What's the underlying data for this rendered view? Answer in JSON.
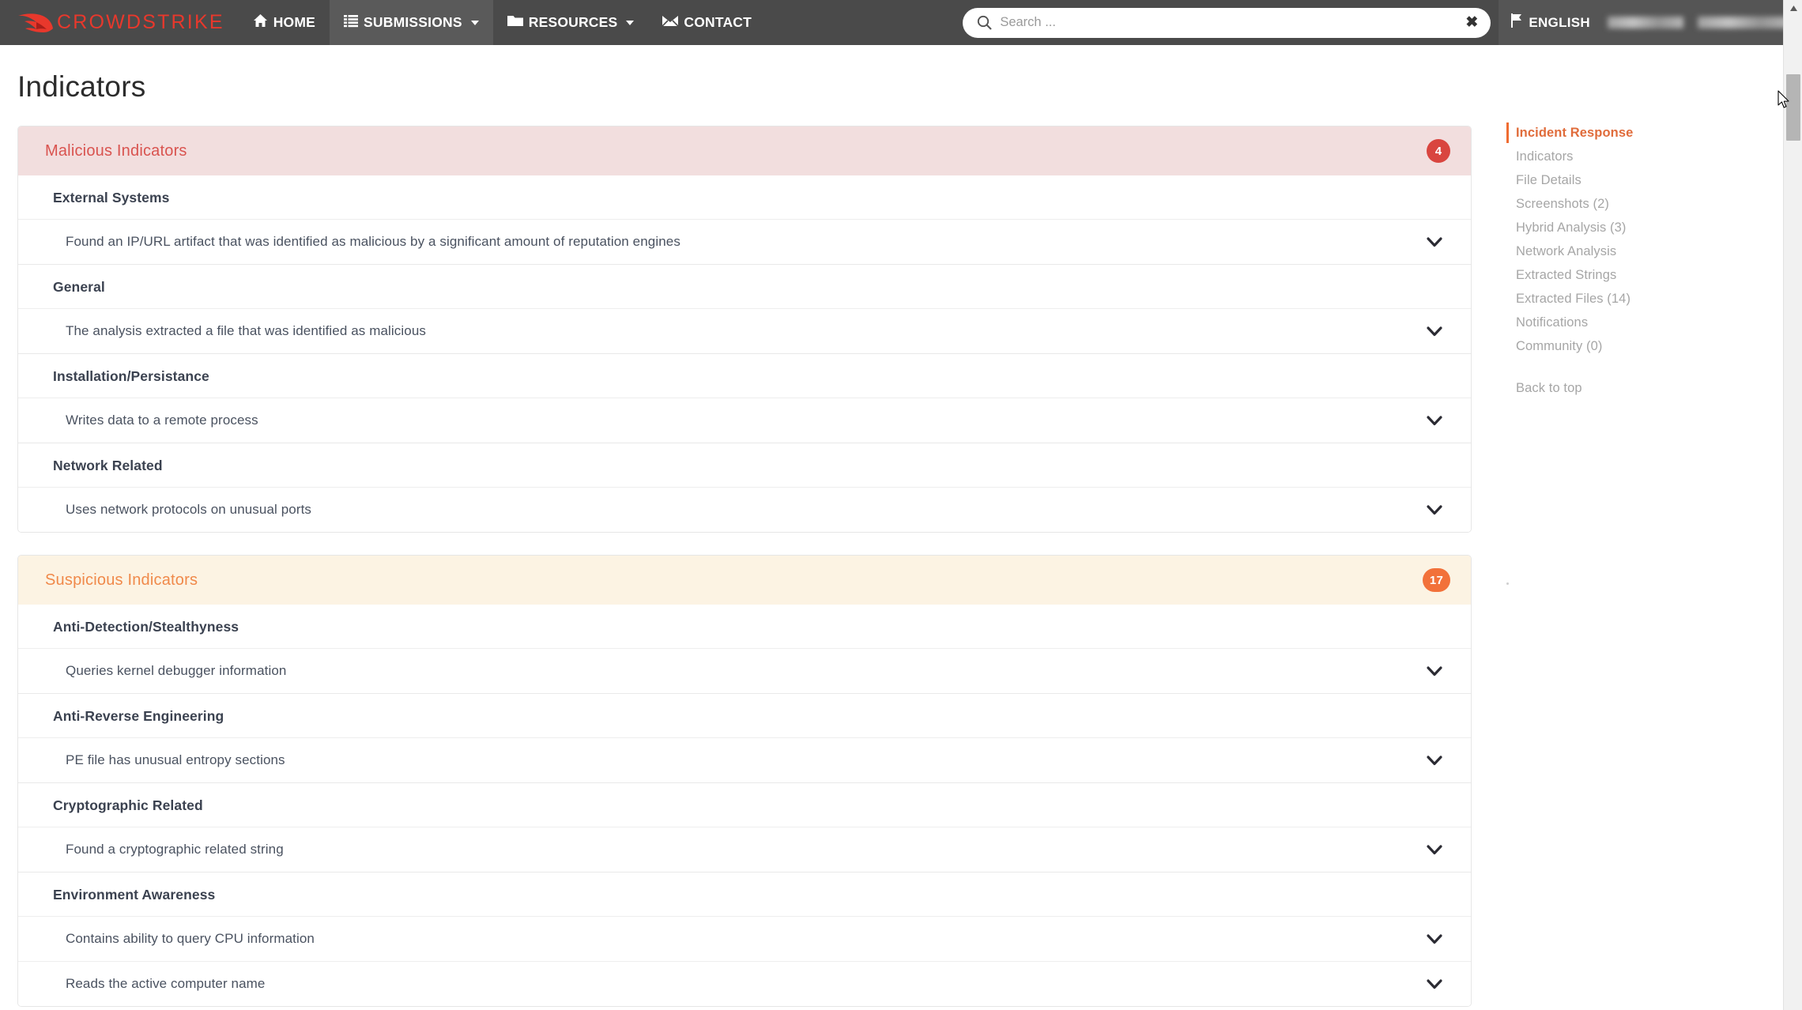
{
  "navbar": {
    "brand": "CROWDSTRIKE",
    "items": [
      {
        "label": "HOME",
        "icon": "home-icon",
        "caret": false,
        "active": false
      },
      {
        "label": "SUBMISSIONS",
        "icon": "list-icon",
        "caret": true,
        "active": true
      },
      {
        "label": "RESOURCES",
        "icon": "folder-icon",
        "caret": true,
        "active": false
      },
      {
        "label": "CONTACT",
        "icon": "envelope-icon",
        "caret": false,
        "active": false
      }
    ],
    "search": {
      "value": "",
      "placeholder": "Search ...",
      "clear_label": "✖"
    },
    "language": "ENGLISH"
  },
  "page": {
    "title": "Indicators"
  },
  "sections": [
    {
      "name": "Malicious Indicators",
      "badge": "4",
      "style": "malicious",
      "groups": [
        {
          "title": "External Systems",
          "rows": [
            "Found an IP/URL artifact that was identified as malicious by a significant amount of reputation engines"
          ]
        },
        {
          "title": "General",
          "rows": [
            "The analysis extracted a file that was identified as malicious"
          ]
        },
        {
          "title": "Installation/Persistance",
          "rows": [
            "Writes data to a remote process"
          ]
        },
        {
          "title": "Network Related",
          "rows": [
            "Uses network protocols on unusual ports"
          ]
        }
      ]
    },
    {
      "name": "Suspicious Indicators",
      "badge": "17",
      "style": "suspicious",
      "groups": [
        {
          "title": "Anti-Detection/Stealthyness",
          "rows": [
            "Queries kernel debugger information"
          ]
        },
        {
          "title": "Anti-Reverse Engineering",
          "rows": [
            "PE file has unusual entropy sections"
          ]
        },
        {
          "title": "Cryptographic Related",
          "rows": [
            "Found a cryptographic related string"
          ]
        },
        {
          "title": "Environment Awareness",
          "rows": [
            "Contains ability to query CPU information",
            "Reads the active computer name"
          ]
        }
      ]
    }
  ],
  "sidebar": {
    "items": [
      {
        "label": "Incident Response",
        "active": true
      },
      {
        "label": "Indicators",
        "active": false
      },
      {
        "label": "File Details",
        "active": false
      },
      {
        "label": "Screenshots (2)",
        "active": false
      },
      {
        "label": "Hybrid Analysis (3)",
        "active": false
      },
      {
        "label": "Network Analysis",
        "active": false
      },
      {
        "label": "Extracted Strings",
        "active": false
      },
      {
        "label": "Extracted Files (14)",
        "active": false
      },
      {
        "label": "Notifications",
        "active": false
      },
      {
        "label": "Community (0)",
        "active": false
      }
    ],
    "back_to_top": "Back to top"
  },
  "colors": {
    "brand_red": "#e8382c",
    "navbar_bg": "#4a4a4a",
    "malicious_header_bg": "#f2dede",
    "malicious_text": "#d9534f",
    "malicious_badge": "#d9453f",
    "suspicious_header_bg": "#fcf3e3",
    "suspicious_text": "#f0894a",
    "suspicious_badge": "#f2713a",
    "sidebar_accent": "#ef6c31"
  }
}
